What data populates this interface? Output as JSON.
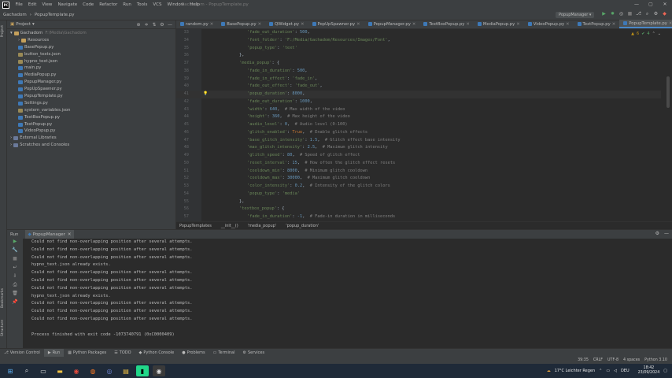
{
  "titlebar": {
    "menu": [
      "File",
      "Edit",
      "View",
      "Navigate",
      "Code",
      "Refactor",
      "Run",
      "Tools",
      "VCS",
      "Window",
      "Help"
    ],
    "title": "Gachadom - PopupTemplate.py"
  },
  "navbar": {
    "project": "Gachadom",
    "file": "PopupTemplate.py",
    "run_config": "PopupManager"
  },
  "project_panel": {
    "title": "Project",
    "root": "Gachadom",
    "root_path": "F:\\Media\\Gachadom",
    "items": [
      {
        "label": "Resources",
        "type": "folder",
        "indent": 2
      },
      {
        "label": "BasePopup.py",
        "type": "py",
        "indent": 2
      },
      {
        "label": "button_texts.json",
        "type": "json",
        "indent": 2
      },
      {
        "label": "hypno_text.json",
        "type": "json",
        "indent": 2
      },
      {
        "label": "main.py",
        "type": "py",
        "indent": 2
      },
      {
        "label": "MediaPopup.py",
        "type": "py",
        "indent": 2
      },
      {
        "label": "PopupManager.py",
        "type": "py",
        "indent": 2
      },
      {
        "label": "PopUpSpawner.py",
        "type": "py",
        "indent": 2
      },
      {
        "label": "PopupTemplate.py",
        "type": "py",
        "indent": 2
      },
      {
        "label": "Settings.py",
        "type": "py",
        "indent": 2
      },
      {
        "label": "system_variables.json",
        "type": "json",
        "indent": 2
      },
      {
        "label": "TextBoxPopup.py",
        "type": "py",
        "indent": 2
      },
      {
        "label": "TextPopup.py",
        "type": "py",
        "indent": 2
      },
      {
        "label": "VideoPopup.py",
        "type": "py",
        "indent": 2
      },
      {
        "label": "External Libraries",
        "type": "lib",
        "indent": 1
      },
      {
        "label": "Scratches and Consoles",
        "type": "lib",
        "indent": 1
      }
    ]
  },
  "editor": {
    "tabs": [
      "random.py",
      "BasePopup.py",
      "QWidget.py",
      "PopUpSpawner.py",
      "PopupManager.py",
      "TextBoxPopup.py",
      "MediaPopup.py",
      "VideoPopup.py",
      "TextPopup.py",
      "PopupTemplate.py"
    ],
    "active_tab": "PopupTemplate.py",
    "inspections": {
      "warnings": "6",
      "weak": "4"
    },
    "lines": [
      {
        "n": "33",
        "parts": [
          [
            "s",
            "'fade_out_duration'"
          ],
          [
            "p",
            ": "
          ],
          [
            "n",
            "500"
          ],
          [
            "p",
            ","
          ]
        ]
      },
      {
        "n": "34",
        "parts": [
          [
            "s",
            "'font_folder'"
          ],
          [
            "p",
            ": "
          ],
          [
            "s",
            "'F:/Media/Gachadom/Resources/Images/Font'"
          ],
          [
            "p",
            ","
          ]
        ]
      },
      {
        "n": "35",
        "parts": [
          [
            "s",
            "'popup_type'"
          ],
          [
            "p",
            ": "
          ],
          [
            "s",
            "'text'"
          ]
        ]
      },
      {
        "n": "36",
        "parts": [
          [
            "p",
            "},"
          ]
        ],
        "indent": -1
      },
      {
        "n": "37",
        "parts": [
          [
            "s",
            "'media_popup'"
          ],
          [
            "p",
            ": {"
          ]
        ],
        "indent": -1
      },
      {
        "n": "38",
        "parts": [
          [
            "s",
            "'fade_in_duration'"
          ],
          [
            "p",
            ": "
          ],
          [
            "n",
            "500"
          ],
          [
            "p",
            ","
          ]
        ]
      },
      {
        "n": "39",
        "parts": [
          [
            "s",
            "'fade_in_effect'"
          ],
          [
            "p",
            ": "
          ],
          [
            "s",
            "'fade_in'"
          ],
          [
            "p",
            ","
          ]
        ]
      },
      {
        "n": "40",
        "parts": [
          [
            "s",
            "'fade_out_effect'"
          ],
          [
            "p",
            ": "
          ],
          [
            "s",
            "'fade_out'"
          ],
          [
            "p",
            ","
          ]
        ]
      },
      {
        "n": "41",
        "parts": [
          [
            "s",
            "'popup_duration'"
          ],
          [
            "p",
            ": "
          ],
          [
            "n",
            "8000"
          ],
          [
            "p",
            ","
          ]
        ],
        "cur": true
      },
      {
        "n": "42",
        "parts": [
          [
            "s",
            "'fade_out_duration'"
          ],
          [
            "p",
            ": "
          ],
          [
            "n",
            "1000"
          ],
          [
            "p",
            ","
          ]
        ]
      },
      {
        "n": "43",
        "parts": [
          [
            "s",
            "'width'"
          ],
          [
            "p",
            ": "
          ],
          [
            "n",
            "640"
          ],
          [
            "p",
            ",  "
          ],
          [
            "c",
            "# Max width of the video"
          ]
        ]
      },
      {
        "n": "44",
        "parts": [
          [
            "s",
            "'height'"
          ],
          [
            "p",
            ": "
          ],
          [
            "n",
            "360"
          ],
          [
            "p",
            ",  "
          ],
          [
            "c",
            "# Max height of the video"
          ]
        ]
      },
      {
        "n": "45",
        "parts": [
          [
            "s",
            "'audio_level'"
          ],
          [
            "p",
            ": "
          ],
          [
            "n",
            "0"
          ],
          [
            "p",
            ",  "
          ],
          [
            "c",
            "# Audio level (0-100)"
          ]
        ]
      },
      {
        "n": "46",
        "parts": [
          [
            "s",
            "'glitch_enabled'"
          ],
          [
            "p",
            ": "
          ],
          [
            "k",
            "True"
          ],
          [
            "p",
            ",  "
          ],
          [
            "c",
            "# Enable glitch effects"
          ]
        ]
      },
      {
        "n": "47",
        "parts": [
          [
            "s",
            "'base_glitch_intensity'"
          ],
          [
            "p",
            ": "
          ],
          [
            "n",
            "1.5"
          ],
          [
            "p",
            ",  "
          ],
          [
            "c",
            "# Glitch effect base intensity"
          ]
        ]
      },
      {
        "n": "48",
        "parts": [
          [
            "s",
            "'max_glitch_intensity'"
          ],
          [
            "p",
            ": "
          ],
          [
            "n",
            "2.5"
          ],
          [
            "p",
            ",  "
          ],
          [
            "c",
            "# Maximum glitch intensity"
          ]
        ]
      },
      {
        "n": "49",
        "parts": [
          [
            "s",
            "'glitch_speed'"
          ],
          [
            "p",
            ": "
          ],
          [
            "n",
            "80"
          ],
          [
            "p",
            ",  "
          ],
          [
            "c",
            "# Speed of glitch effect"
          ]
        ]
      },
      {
        "n": "50",
        "parts": [
          [
            "s",
            "'reset_interval'"
          ],
          [
            "p",
            ": "
          ],
          [
            "n",
            "15"
          ],
          [
            "p",
            ",  "
          ],
          [
            "c",
            "# How often the glitch effect resets"
          ]
        ]
      },
      {
        "n": "51",
        "parts": [
          [
            "s",
            "'cooldown_min'"
          ],
          [
            "p",
            ": "
          ],
          [
            "n",
            "8000"
          ],
          [
            "p",
            ",  "
          ],
          [
            "c",
            "# Minimum glitch cooldown"
          ]
        ]
      },
      {
        "n": "52",
        "parts": [
          [
            "s",
            "'cooldown_max'"
          ],
          [
            "p",
            ": "
          ],
          [
            "n",
            "30000"
          ],
          [
            "p",
            ",  "
          ],
          [
            "c",
            "# Maximum glitch cooldown"
          ]
        ]
      },
      {
        "n": "53",
        "parts": [
          [
            "s",
            "'color_intensity'"
          ],
          [
            "p",
            ": "
          ],
          [
            "n",
            "0.2"
          ],
          [
            "p",
            ",  "
          ],
          [
            "c",
            "# Intensity of the glitch colors"
          ]
        ]
      },
      {
        "n": "54",
        "parts": [
          [
            "s",
            "'popup_type'"
          ],
          [
            "p",
            ": "
          ],
          [
            "s",
            "'media'"
          ]
        ]
      },
      {
        "n": "55",
        "parts": [
          [
            "p",
            "},"
          ]
        ],
        "indent": -1
      },
      {
        "n": "56",
        "parts": [
          [
            "s",
            "'textbox_popup'"
          ],
          [
            "p",
            ": {"
          ]
        ],
        "indent": -1
      },
      {
        "n": "57",
        "parts": [
          [
            "s",
            "'fade_in_duration'"
          ],
          [
            "p",
            ": "
          ],
          [
            "n",
            "-1"
          ],
          [
            "p",
            ",  "
          ],
          [
            "c",
            "# Fade-in duration in milliseconds"
          ]
        ]
      }
    ],
    "breadcrumb": [
      "PopupTemplates",
      "__init__()",
      "'media_popup'",
      "'popup_duration'"
    ]
  },
  "run_panel": {
    "label": "Run",
    "tab": "PopupManager",
    "output": [
      "Could not find non-overlapping position after several attempts.",
      "Could not find non-overlapping position after several attempts.",
      "Could not find non-overlapping position after several attempts.",
      "hypno_text.json already exists.",
      "Could not find non-overlapping position after several attempts.",
      "Could not find non-overlapping position after several attempts.",
      "Could not find non-overlapping position after several attempts.",
      "hypno_text.json already exists.",
      "Could not find non-overlapping position after several attempts.",
      "Could not find non-overlapping position after several attempts.",
      "Could not find non-overlapping position after several attempts.",
      "",
      "Process finished with exit code -1073740791 (0xC0000409)"
    ]
  },
  "bottom_tabs": [
    "Version Control",
    "Run",
    "Python Packages",
    "TODO",
    "Python Console",
    "Problems",
    "Terminal",
    "Services"
  ],
  "statusbar": [
    "39:35",
    "CRLF",
    "UTF-8",
    "4 spaces",
    "Python 3.10"
  ],
  "left_strip": {
    "top": "Project",
    "bottom": "Bookmarks",
    "bottom2": "Structure"
  },
  "taskbar": {
    "weather": "17°C  Leichter Regen",
    "lang": "DEU",
    "time": "18:42",
    "date": "23/09/2024"
  }
}
